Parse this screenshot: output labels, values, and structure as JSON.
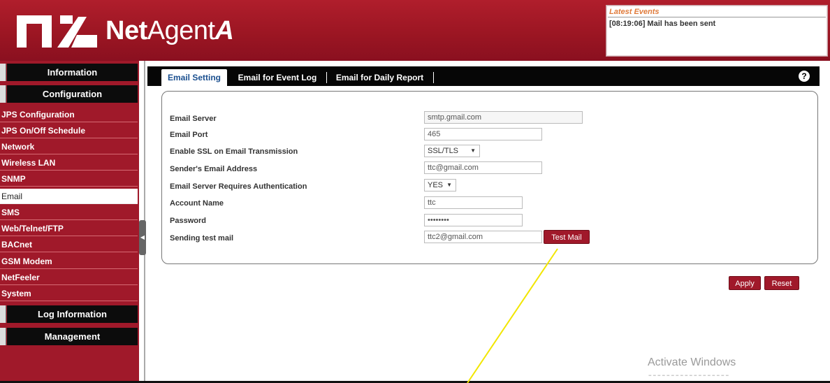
{
  "header": {
    "brand_part1": "Net",
    "brand_part2": "Agent",
    "brand_part3": "A",
    "latest_events_title": "Latest Events",
    "latest_events_text": "[08:19:06] Mail has been sent"
  },
  "sidebar": {
    "sections": {
      "information": "Information",
      "configuration": "Configuration",
      "log_information": "Log Information",
      "management": "Management"
    },
    "items": [
      {
        "label": "JPS Configuration"
      },
      {
        "label": "JPS On/Off Schedule"
      },
      {
        "label": "Network"
      },
      {
        "label": "Wireless LAN"
      },
      {
        "label": "SNMP"
      },
      {
        "label": "Email"
      },
      {
        "label": "SMS"
      },
      {
        "label": "Web/Telnet/FTP"
      },
      {
        "label": "BACnet"
      },
      {
        "label": "GSM Modem"
      },
      {
        "label": "NetFeeler"
      },
      {
        "label": "System"
      }
    ],
    "active_item": "Email"
  },
  "tabs": [
    {
      "label": "Email Setting",
      "active": true
    },
    {
      "label": "Email for Event Log",
      "active": false
    },
    {
      "label": "Email for Daily Report",
      "active": false
    }
  ],
  "help_icon": "?",
  "form": {
    "email_server": {
      "label": "Email Server",
      "value": "smtp.gmail.com"
    },
    "email_port": {
      "label": "Email Port",
      "value": "465"
    },
    "ssl": {
      "label": "Enable SSL on Email Transmission",
      "value": "SSL/TLS"
    },
    "sender": {
      "label": "Sender's Email Address",
      "value": "ttc@gmail.com"
    },
    "auth": {
      "label": "Email Server Requires Authentication",
      "value": "YES"
    },
    "account": {
      "label": "Account Name",
      "value": "ttc"
    },
    "password": {
      "label": "Password",
      "value": "••••••••"
    },
    "test_mail": {
      "label": "Sending test mail",
      "value": "ttc2@gmail.com",
      "button": "Test Mail"
    }
  },
  "actions": {
    "apply": "Apply",
    "reset": "Reset"
  },
  "watermark": {
    "line1": "Activate Windows"
  },
  "colors": {
    "brand_red": "#a0192a",
    "tab_active_text": "#1a4f8f",
    "annotation": "#f2e600"
  }
}
